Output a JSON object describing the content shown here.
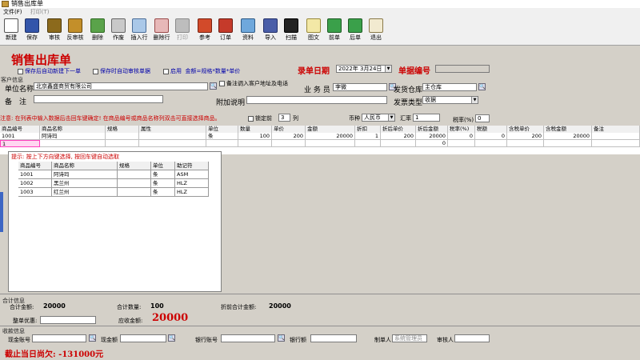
{
  "window": {
    "title": "销售出库单"
  },
  "menu": {
    "file": "文件(F)",
    "print": "打印(T)"
  },
  "toolbar": [
    {
      "label": "新建",
      "icon": "new-doc-icon",
      "color": "#ffffff",
      "border": "#555555"
    },
    {
      "label": "保存",
      "icon": "save-icon",
      "color": "#3355aa",
      "border": "#1d2f66"
    },
    {
      "label": "审核",
      "icon": "audit-icon",
      "color": "#8c6a1c",
      "border": "#4e3a0c"
    },
    {
      "label": "反审核",
      "icon": "unaudit-icon",
      "color": "#c38f2a",
      "border": "#6b4c10"
    },
    {
      "label": "删除",
      "icon": "delete-icon",
      "color": "#5aa34a",
      "border": "#2f6a22"
    },
    {
      "label": "作废",
      "icon": "void-icon",
      "color": "#c9c9c9",
      "border": "#666666"
    },
    {
      "label": "插入行",
      "icon": "insert-row-icon",
      "color": "#aac8e8",
      "border": "#4b6e99"
    },
    {
      "label": "删除行",
      "icon": "delete-row-icon",
      "color": "#e7b8b8",
      "border": "#9a4b4b"
    },
    {
      "label": "打印",
      "icon": "print-icon",
      "color": "#bdbdbd",
      "border": "#8a8a8a",
      "disabled": true
    },
    {
      "label": "参考",
      "icon": "reference-icon",
      "color": "#d24a2a",
      "border": "#7a2210"
    },
    {
      "label": "订单",
      "icon": "order-icon",
      "color": "#c53a2a",
      "border": "#6c1a10"
    },
    {
      "label": "资料",
      "icon": "data-icon",
      "color": "#6fa8dc",
      "border": "#2d5a86"
    },
    {
      "label": "导入",
      "icon": "import-icon",
      "color": "#4a5ea8",
      "border": "#23306a"
    },
    {
      "label": "扫描",
      "icon": "barcode-icon",
      "color": "#222222",
      "border": "#000000"
    },
    {
      "label": "图文",
      "icon": "image-text-icon",
      "color": "#f3e8a6",
      "border": "#9a8a3a"
    },
    {
      "label": "前单",
      "icon": "prev-arrow-icon",
      "color": "#3aa04a",
      "border": "#1c5a22"
    },
    {
      "label": "后单",
      "icon": "next-arrow-icon",
      "color": "#3aa04a",
      "border": "#1c5a22"
    },
    {
      "label": "退出",
      "icon": "exit-icon",
      "color": "#f2ead0",
      "border": "#8a7a4a"
    }
  ],
  "header": {
    "title": "销售出库单",
    "opt_auto_new": "保存后自动新建下一单",
    "opt_auto_audit": "保存时自动审核单据",
    "opt_enable_amount": "启用",
    "opt_enable_amount_formula": "金额=规格*数量*单价",
    "date_label": "录单日期",
    "date_value": "2022年 3月24日",
    "docno_label": "单据编号",
    "docno_value": ""
  },
  "customer": {
    "section": "客户信息",
    "unit_label": "单位名称",
    "unit_value": "北京鑫盛商贸有限公司",
    "remark_label": "备　注",
    "remark_value": "",
    "bring_addr_label": "备注调入客户地址及电话",
    "salesman_label": "业 务 员",
    "salesman_value": "李微",
    "warehouse_label": "发货仓库",
    "warehouse_value": "主仓库",
    "extra_label": "附加说明",
    "extra_value": "",
    "invoice_label": "发票类型",
    "invoice_value": "收据"
  },
  "notice": {
    "text": "注意: 在列表中输入数据后击回车键确定! 在商品编号或商品名称列双击可直接选择商品。",
    "lock_label": "锁定前",
    "lock_value": "3",
    "lock_unit": "列",
    "currency_label": "币种",
    "currency_value": "人民币",
    "rate_label": "汇率",
    "rate_value": "1",
    "tax_label": "税率(%)",
    "tax_value": "0"
  },
  "grid": {
    "columns": [
      "商品编号",
      "商品名称",
      "规格",
      "属性",
      "单位",
      "数量",
      "单价",
      "金额",
      "折扣",
      "折后单价",
      "折后金额",
      "税率(%)",
      "税额",
      "含税单价",
      "含税金额",
      "备注"
    ],
    "rows": [
      [
        "1001",
        "阿诗玛",
        "",
        "",
        "条",
        "100",
        "200",
        "20000",
        "1",
        "200",
        "20000",
        "0",
        "0",
        "200",
        "20000",
        ""
      ],
      [
        "1",
        "",
        "",
        "",
        "",
        "",
        "",
        "",
        "",
        "",
        "0",
        "",
        "",
        "",
        "",
        ""
      ]
    ]
  },
  "popup": {
    "hint": "提示: 按上下方向键选择, 按回车键自动选取",
    "columns": [
      "商品编号",
      "商品名称",
      "规格",
      "单位",
      "助记符"
    ],
    "rows": [
      [
        "1001",
        "阿诗玛",
        "",
        "条",
        "ASM"
      ],
      [
        "1002",
        "黑兰州",
        "",
        "条",
        "HLZ"
      ],
      [
        "1003",
        "红兰州",
        "",
        "条",
        "HLZ"
      ]
    ]
  },
  "summary": {
    "section": "合计信息",
    "total_amount_label": "合计金额:",
    "total_amount": "20000",
    "total_qty_label": "合计数量:",
    "total_qty": "100",
    "total_pre_discount_label": "折前合计金额:",
    "total_pre_discount": "20000",
    "discount_label": "整单优惠:",
    "discount_value": "",
    "receivable_label": "应收金额:",
    "receivable": "20000"
  },
  "payment": {
    "section": "收款信息",
    "cash_account_label": "现金账号",
    "cash_amount_label": "现金额",
    "bank_account_label": "银行账号",
    "bank_amount_label": "银行额",
    "maker_label": "制单人",
    "maker_value": "系统管理员",
    "auditor_label": "审核人",
    "owed": "截止当日尚欠: -131000元"
  }
}
